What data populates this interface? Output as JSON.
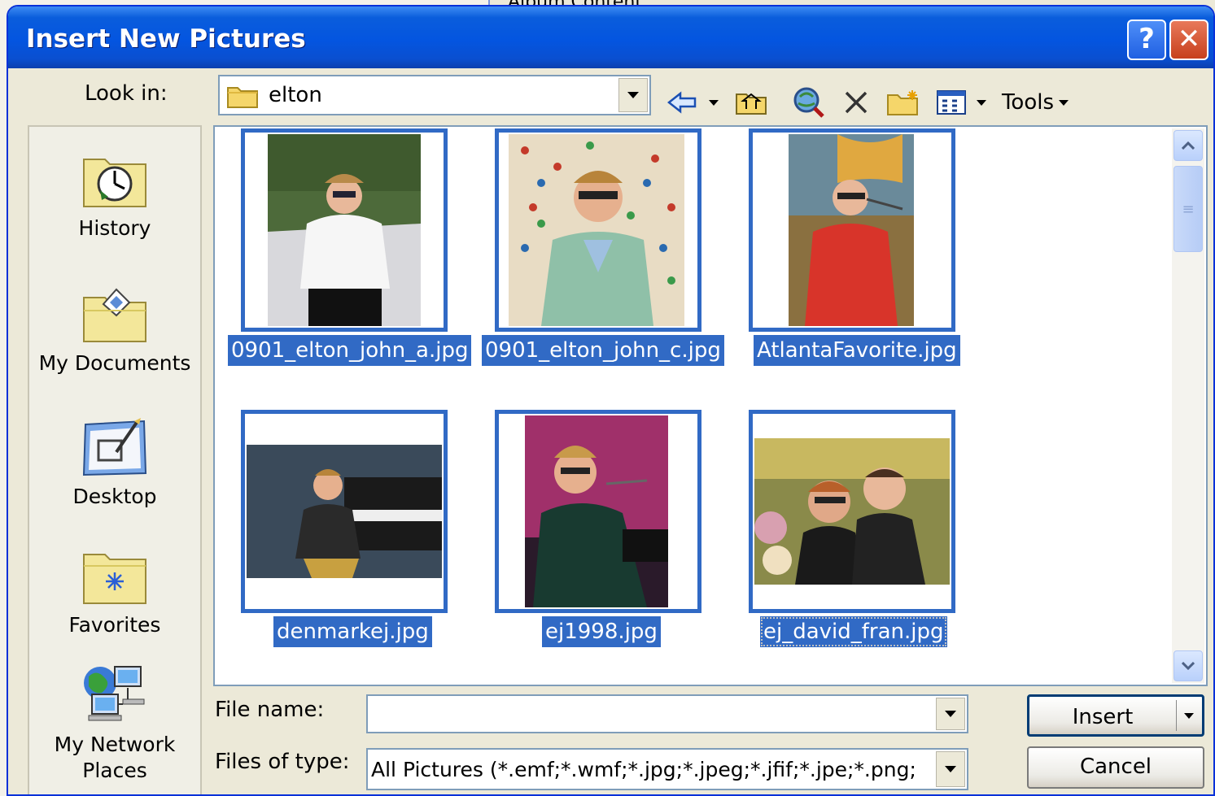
{
  "background_window": {
    "title_fragment": "Album Content"
  },
  "window": {
    "title": "Insert New Pictures",
    "help_label": "?",
    "close_label": "✕"
  },
  "toolbar": {
    "look_in_label": "Look in:",
    "look_in_value": "elton",
    "tools_label": "Tools"
  },
  "places": [
    {
      "label": "History",
      "icon": "history-icon"
    },
    {
      "label": "My Documents",
      "icon": "my-documents-icon"
    },
    {
      "label": "Desktop",
      "icon": "desktop-icon"
    },
    {
      "label": "Favorites",
      "icon": "favorites-icon"
    },
    {
      "label": "My Network Places",
      "icon": "network-places-icon"
    }
  ],
  "files": [
    {
      "name": "0901_elton_john_a.jpg",
      "selected": true
    },
    {
      "name": "0901_elton_john_c.jpg",
      "selected": true
    },
    {
      "name": "AtlantaFavorite.jpg",
      "selected": true
    },
    {
      "name": "denmarkej.jpg",
      "selected": true
    },
    {
      "name": "ej1998.jpg",
      "selected": true
    },
    {
      "name": "ej_david_fran.jpg",
      "selected": true,
      "focused": true
    }
  ],
  "form": {
    "file_name_label": "File name:",
    "file_name_value": "",
    "files_of_type_label": "Files of type:",
    "files_of_type_value": "All Pictures (*.emf;*.wmf;*.jpg;*.jpeg;*.jfif;*.jpe;*.png;"
  },
  "buttons": {
    "insert": "Insert",
    "cancel": "Cancel"
  },
  "colors": {
    "selection": "#316ac5",
    "title_bar": "#0455e0",
    "dialog_bg": "#ece9d8"
  }
}
